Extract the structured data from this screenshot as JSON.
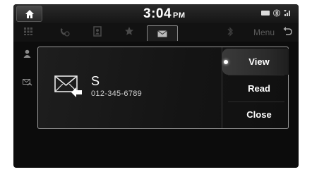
{
  "status": {
    "time": "3:04",
    "ampm": "PM"
  },
  "tabs": [
    {
      "name": "keypad-icon"
    },
    {
      "name": "call-history-icon"
    },
    {
      "name": "contacts-icon"
    },
    {
      "name": "favorites-icon"
    },
    {
      "name": "messages-icon",
      "selected": true
    },
    {
      "name": "bluetooth-icon"
    }
  ],
  "tabbar": {
    "menu_label": "Menu"
  },
  "message": {
    "sender": "S",
    "number": "012-345-6789"
  },
  "popup_menu": {
    "items": [
      {
        "label": "View",
        "selected": true
      },
      {
        "label": "Read"
      },
      {
        "label": "Close"
      }
    ]
  }
}
